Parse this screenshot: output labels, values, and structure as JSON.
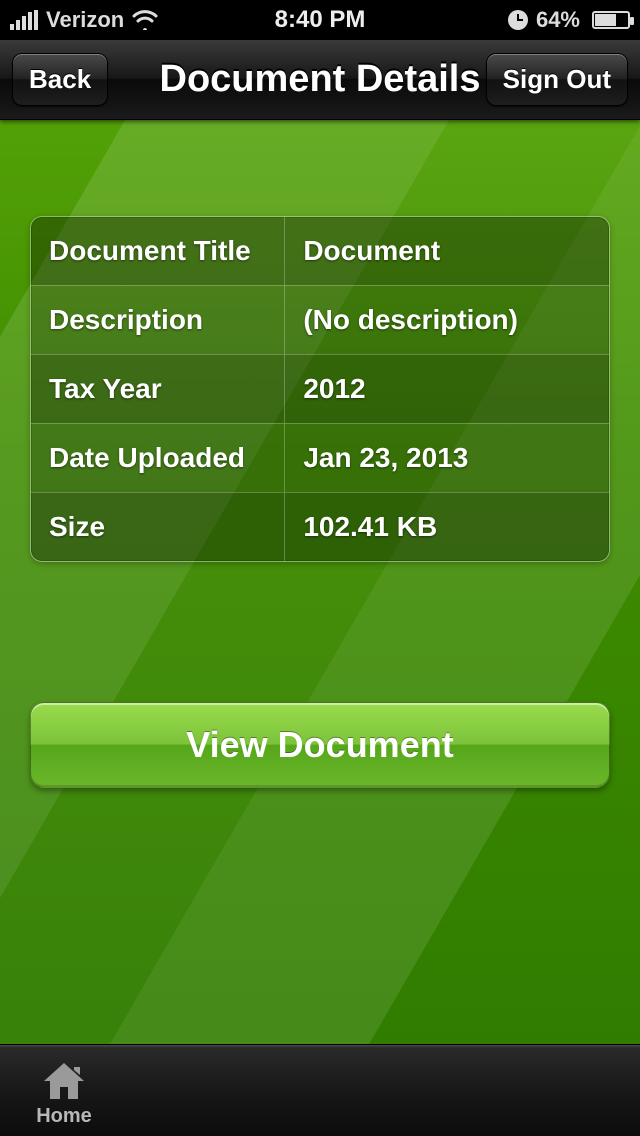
{
  "status": {
    "carrier": "Verizon",
    "time": "8:40 PM",
    "battery_pct": "64%"
  },
  "nav": {
    "back_label": "Back",
    "title": "Document Details",
    "signout_label": "Sign Out"
  },
  "details": {
    "rows": [
      {
        "label": "Document Title",
        "value": "Document"
      },
      {
        "label": "Description",
        "value": "(No description)"
      },
      {
        "label": "Tax Year",
        "value": "2012"
      },
      {
        "label": "Date Uploaded",
        "value": "Jan 23, 2013"
      },
      {
        "label": "Size",
        "value": "102.41 KB"
      }
    ]
  },
  "actions": {
    "view_label": "View Document"
  },
  "tabbar": {
    "home_label": "Home"
  }
}
